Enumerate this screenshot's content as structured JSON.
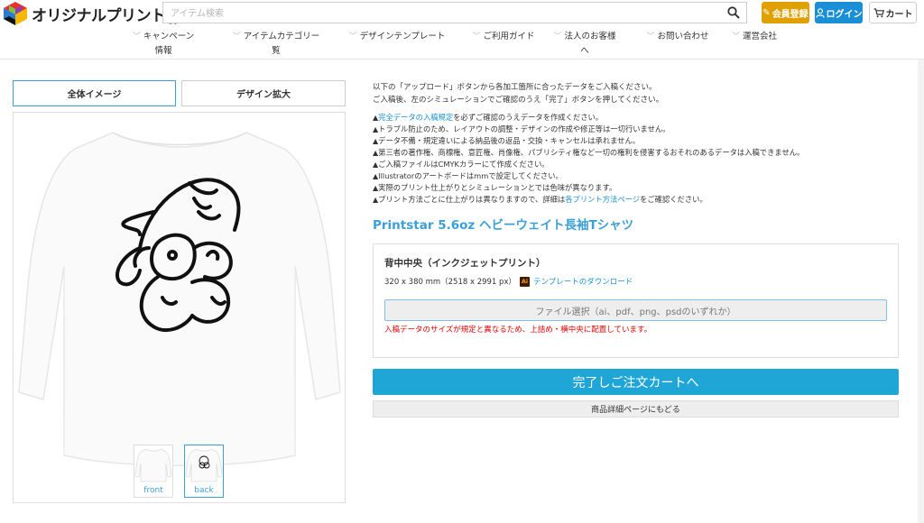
{
  "header": {
    "logo_text": "オリジナルプリント.jp",
    "search_placeholder": "アイテム検索",
    "member_label": "会員登録",
    "login_label": "ログイン",
    "cart_label": "カート",
    "colors": {
      "member": "#e0a100",
      "login": "#1a8fd6"
    }
  },
  "nav": {
    "items": [
      {
        "label": "キャンペーン情報"
      },
      {
        "label": "アイテムカテゴリー覧"
      },
      {
        "label": "デザインテンプレート"
      },
      {
        "label": "ご利用ガイド"
      },
      {
        "label": "法人のお客様へ"
      },
      {
        "label": "お問い合わせ"
      },
      {
        "label": "運営会社"
      }
    ]
  },
  "left": {
    "tab_full": "全体イメージ",
    "tab_zoom": "デザイン拡大",
    "thumbs": [
      {
        "label": "front"
      },
      {
        "label": "back"
      }
    ]
  },
  "right": {
    "intro_1": "以下の「アップロード」ボタンから各加工箇所に合ったデータをご入稿ください。",
    "intro_2": "ご入稿後、左のシミュレーションでご確認のうえ「完了」ボタンを押してください。",
    "note_1_link": "完全データの入稿規定",
    "note_1_rest": "を必ずご確認のうえデータを作成ください。",
    "note_2": "トラブル防止のため、レイアウトの調整・デザインの作成や修正等は一切行いません。",
    "note_3": "データ不備・規定違いによる納品後の返品・交換・キャンセルは承れません。",
    "note_4": "第三者の著作権、商標権、意匠権、肖像権、パブリシティ権など一切の権利を侵害するおそれのあるデータは入稿できません。",
    "note_5": "ご入稿ファイルはCMYKカラーにて作成ください。",
    "note_6": "Illustratorのアートボードはmmで設定してください。",
    "note_7": "実際のプリント仕上がりとシミュレーションとでは色味が異なります。",
    "note_8_pre": "プリント方法ごとに仕上がりは異なりますので、詳細は",
    "note_8_link": "各プリント方法ページ",
    "note_8_post": "をご確認ください。",
    "product_title": "Printstar 5.6oz ヘビーウェイト長袖Tシャツ",
    "position_title": "背中中央（インクジェットプリント）",
    "size_text": "320 x 380 mm（2518 x 2991 px）",
    "ai_icon": "Ai",
    "template_link": "テンプレートのダウンロード",
    "file_button": "ファイル選択（ai、pdf、png、psdのいずれか）",
    "warning": "入稿データのサイズが規定と異なるため、上詰め・横中央に配置しています。",
    "cart_button": "完了しご注文カートへ",
    "back_button": "商品詳細ページにもどる",
    "colors": {
      "accent": "#1fa6d6",
      "warning": "#e60000"
    }
  }
}
